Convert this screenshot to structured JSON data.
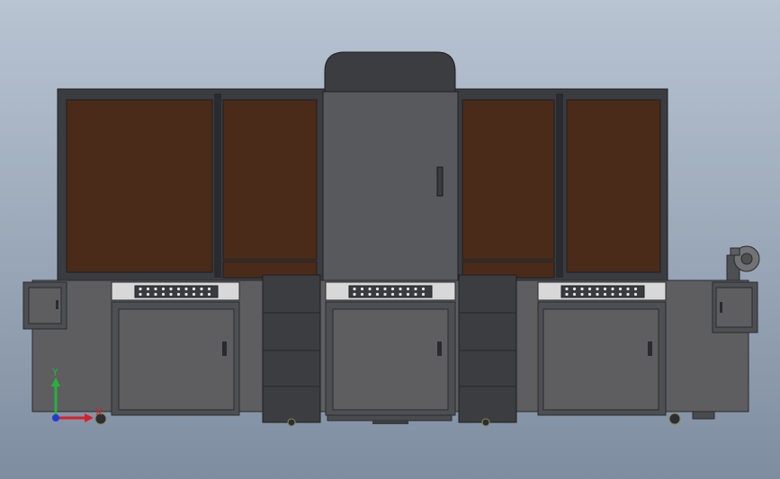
{
  "viewport": {
    "background_top": "#b8c4d2",
    "background_bottom": "#7e8da0"
  },
  "colors": {
    "frame": "#3a3c40",
    "frame_dark": "#2a2b2e",
    "glass": "#4a2a18",
    "cabinet": "#5e5e60",
    "cabinet_dark": "#4e4f52",
    "panel_light": "#d8d8d8",
    "dark_block": "#3c3d40",
    "axis_x": "#d9202a",
    "axis_y": "#25b33b",
    "axis_z": "#1e3bd6"
  },
  "triad": {
    "x_label": "X",
    "y_label": "Y",
    "x_color": "#d9202a",
    "y_color": "#25b33b"
  }
}
